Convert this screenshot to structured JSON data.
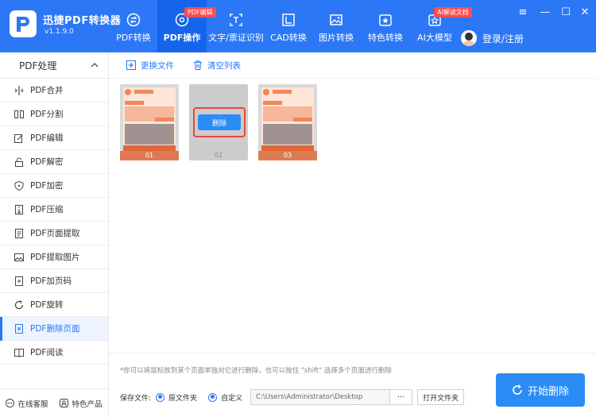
{
  "app": {
    "name": "迅捷PDF转换器",
    "version": "v1.1.9.0"
  },
  "nav": [
    {
      "label": "PDF转换",
      "icon": "convert-icon",
      "badge": ""
    },
    {
      "label": "PDF操作",
      "icon": "pdf-ops-icon",
      "badge": "PDF编辑",
      "active": true
    },
    {
      "label": "文字/票证识别",
      "icon": "ocr-icon",
      "badge": ""
    },
    {
      "label": "CAD转换",
      "icon": "cad-icon",
      "badge": ""
    },
    {
      "label": "图片转换",
      "icon": "image-icon",
      "badge": ""
    },
    {
      "label": "特色转换",
      "icon": "feature-icon",
      "badge": ""
    },
    {
      "label": "AI大模型",
      "icon": "ai-icon",
      "badge": "AI解读文档"
    }
  ],
  "login": {
    "label": "登录/注册"
  },
  "window_controls": {
    "menu": "≡",
    "minimize": "—",
    "maximize": "☐",
    "close": "✕"
  },
  "sidebar": {
    "header": "PDF处理",
    "items": [
      {
        "label": "PDF合并",
        "icon": "merge-icon"
      },
      {
        "label": "PDF分割",
        "icon": "split-icon"
      },
      {
        "label": "PDF编辑",
        "icon": "edit-icon"
      },
      {
        "label": "PDF解密",
        "icon": "unlock-icon"
      },
      {
        "label": "PDF加密",
        "icon": "shield-icon"
      },
      {
        "label": "PDF压缩",
        "icon": "compress-icon"
      },
      {
        "label": "PDF页面提取",
        "icon": "extract-page-icon"
      },
      {
        "label": "PDF提取图片",
        "icon": "extract-image-icon"
      },
      {
        "label": "PDF加页码",
        "icon": "page-number-icon"
      },
      {
        "label": "PDF旋转",
        "icon": "rotate-icon"
      },
      {
        "label": "PDF删除页面",
        "icon": "delete-page-icon",
        "active": true
      },
      {
        "label": "PDF阅读",
        "icon": "book-icon"
      }
    ],
    "bottom": [
      {
        "label": "在线客服",
        "icon": "chat-icon"
      },
      {
        "label": "特色产品",
        "icon": "product-icon"
      }
    ]
  },
  "toolbar": {
    "replace_label": "更换文件",
    "clear_label": "清空列表"
  },
  "pages": [
    {
      "num": "01",
      "selected": false
    },
    {
      "num": "02",
      "selected": true
    },
    {
      "num": "03",
      "selected": false
    }
  ],
  "delete_label": "删除",
  "tip": "*你可以将鼠标放到某个页面单独对它进行删除，也可以按住 \"shift\" 选择多个页面进行删除",
  "save": {
    "label": "保存文件:",
    "option_original": "原文件夹",
    "option_custom": "自定义",
    "path": "C:\\Users\\Administrator\\Desktop",
    "dots": "···",
    "open_label": "打开文件夹"
  },
  "start_label": "开始删除",
  "colors": {
    "primary": "#2b77f6",
    "danger": "#e5483b",
    "accent_orange": "#f6a882"
  }
}
